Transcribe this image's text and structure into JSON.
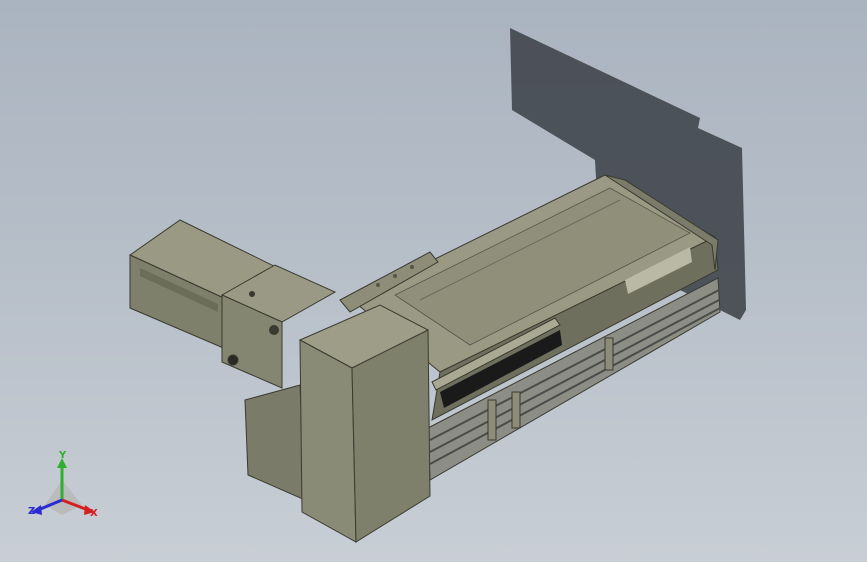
{
  "viewport": {
    "background_top": "#aab4c0",
    "background_bottom": "#c8ced5"
  },
  "model": {
    "body_color": "#7f806b",
    "body_light": "#9a9a84",
    "body_dark": "#5d5e4e",
    "rail_color": "#8c8e86",
    "rail_dark": "#4a4c48",
    "slot_color": "#1a1a1a",
    "shadow_color": "#3b4046"
  },
  "triad": {
    "x_label": "X",
    "y_label": "Y",
    "z_label": "Z",
    "x_color": "#d42020",
    "y_color": "#2fae2f",
    "z_color": "#2b2bd0"
  }
}
